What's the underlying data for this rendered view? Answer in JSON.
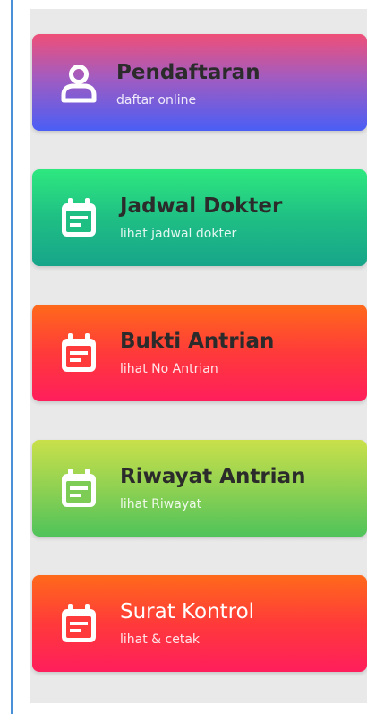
{
  "menu": {
    "items": [
      {
        "title": "Pendaftaran",
        "subtitle": "daftar online",
        "icon": "user-icon"
      },
      {
        "title": "Jadwal Dokter",
        "subtitle": "lihat jadwal dokter",
        "icon": "calendar-icon"
      },
      {
        "title": "Bukti Antrian",
        "subtitle": "lihat No Antrian",
        "icon": "calendar-icon"
      },
      {
        "title": "Riwayat Antrian",
        "subtitle": "lihat Riwayat",
        "icon": "calendar-icon"
      },
      {
        "title": "Surat Kontrol",
        "subtitle": "lihat & cetak",
        "icon": "calendar-icon"
      }
    ]
  },
  "colors": {
    "frame_border": "#4a90d9",
    "panel_bg": "#e9e9e9",
    "title_text": "#2b2b2b",
    "icon_white": "#ffffff"
  }
}
